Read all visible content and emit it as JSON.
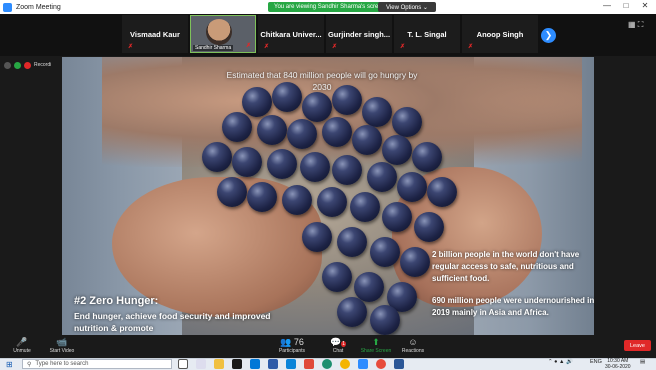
{
  "window": {
    "title": "Zoom Meeting",
    "share_banner": "You are viewing Sandhir Sharma's screen",
    "view_options": "View Options ⌄",
    "controls": {
      "minimize": "—",
      "maximize": "□",
      "close": "✕"
    }
  },
  "participants": [
    {
      "name": "Vismaad Kaur",
      "muted": true
    },
    {
      "name": "Sandhir Sharma",
      "muted": true,
      "video": true
    },
    {
      "name": "Chitkara Univer...",
      "muted": true
    },
    {
      "name": "Gurjinder singh...",
      "muted": true
    },
    {
      "name": "T. L. Singal",
      "muted": true
    },
    {
      "name": "Anoop Singh",
      "muted": true
    }
  ],
  "recording": {
    "label": "Recordi"
  },
  "slide": {
    "top_text": "Estimated that 840 million people will go hungry by 2030",
    "right_text_1": "2 billion people in the world don't have regular access to safe, nutritious and sufficient food.",
    "right_text_2": "690 million people were undernourished in 2019 mainly in Asia and Africa.",
    "heading": "#2 Zero Hunger:",
    "subheading": "End hunger, achieve food security and improved nutrition & promote"
  },
  "toolbar": {
    "unmute": "Unmute",
    "start_video": "Start Video",
    "participants": "Participants",
    "participants_count": "76",
    "chat": "Chat",
    "chat_badge": "1",
    "share_screen": "Share Screen",
    "reactions": "Reactions",
    "leave": "Leave"
  },
  "taskbar": {
    "search_placeholder": "Type here to search",
    "language": "ENG",
    "time": "10:30 AM",
    "date": "30-06-2020"
  },
  "colors": {
    "zoom_blue": "#2d8cff",
    "share_green": "#27a744",
    "leave_red": "#e02828"
  }
}
